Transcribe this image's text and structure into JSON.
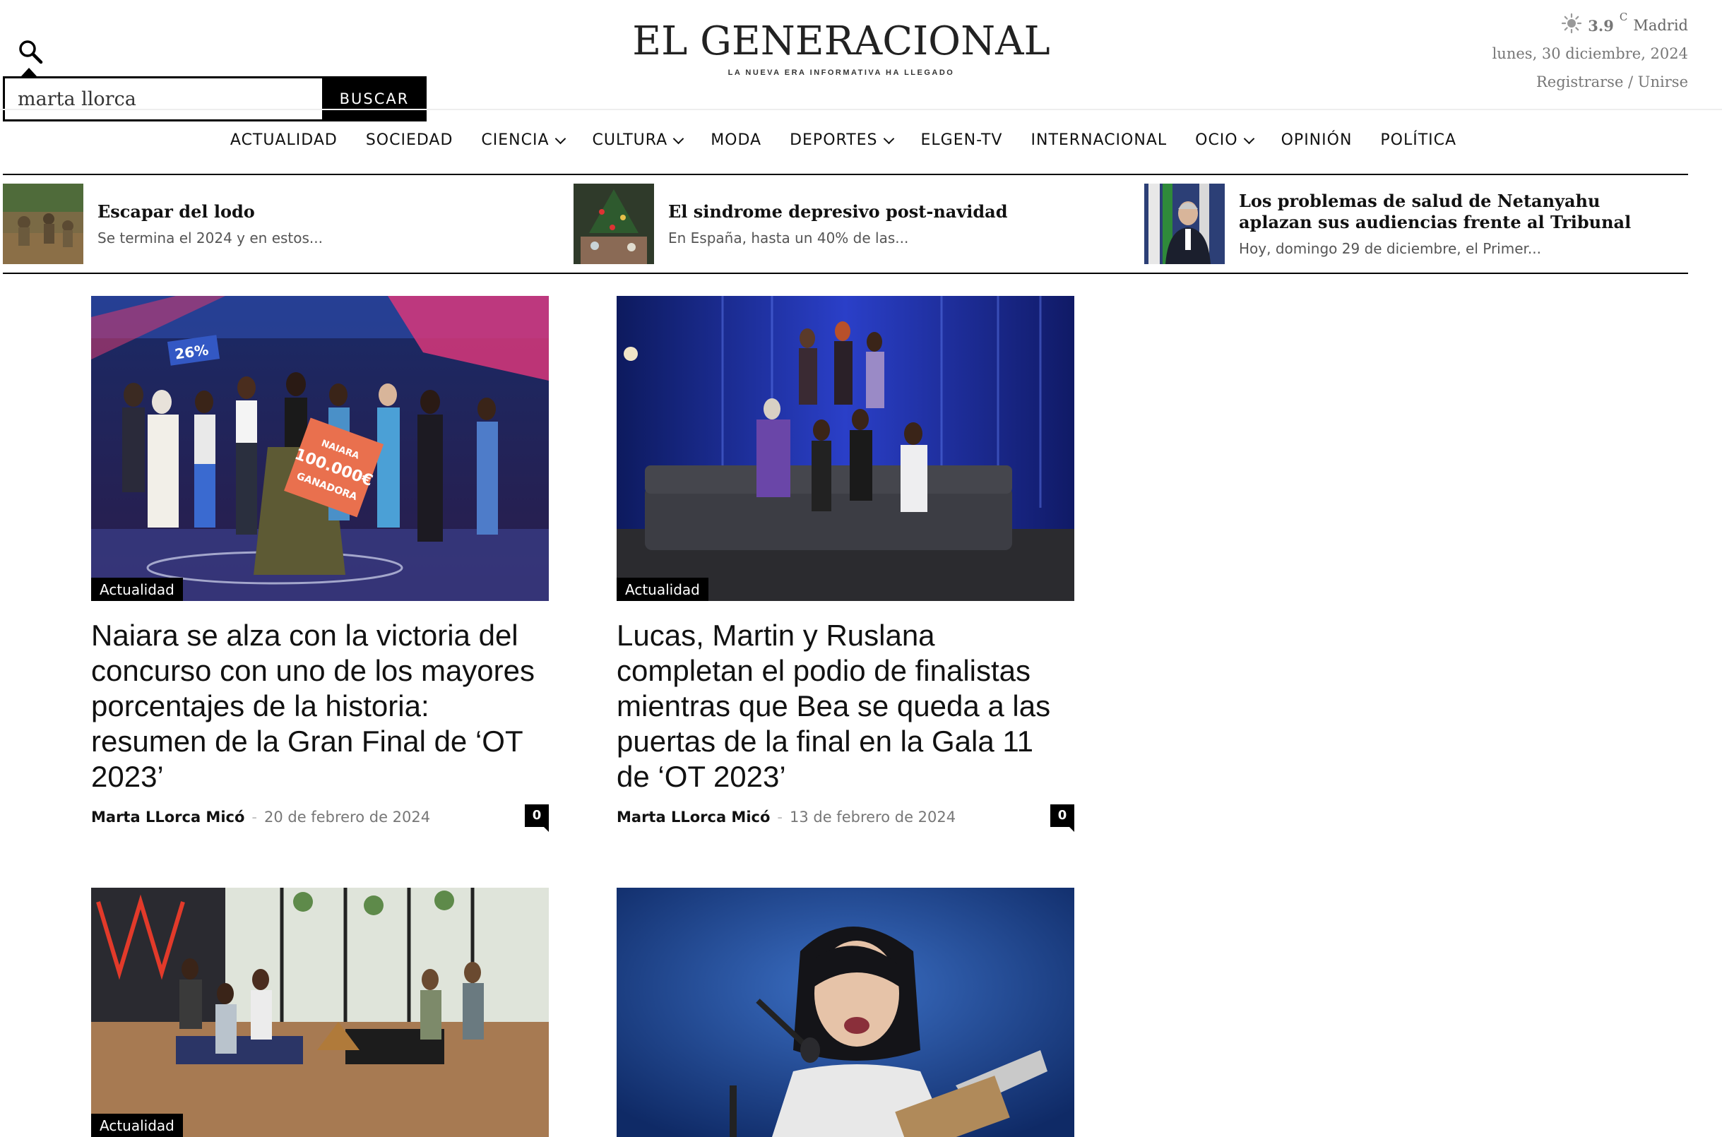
{
  "header": {
    "logo": "EL GENERACIONAL",
    "tagline": "LA NUEVA ERA INFORMATIVA HA LLEGADO",
    "weather": {
      "temp": "3.9",
      "unit": "C",
      "city": "Madrid",
      "icon": "sun-icon"
    },
    "date": "lunes, 30 diciembre, 2024",
    "auth": "Registrarse / Unirse"
  },
  "search": {
    "value": "marta llorca",
    "button_label": "BUSCAR",
    "icon": "search-icon"
  },
  "nav": [
    {
      "label": "ACTUALIDAD",
      "dropdown": false
    },
    {
      "label": "SOCIEDAD",
      "dropdown": false
    },
    {
      "label": "CIENCIA",
      "dropdown": true
    },
    {
      "label": "CULTURA",
      "dropdown": true
    },
    {
      "label": "MODA",
      "dropdown": false
    },
    {
      "label": "DEPORTES",
      "dropdown": true
    },
    {
      "label": "ELGEN-TV",
      "dropdown": false
    },
    {
      "label": "INTERNACIONAL",
      "dropdown": false
    },
    {
      "label": "OCIO",
      "dropdown": true
    },
    {
      "label": "OPINIÓN",
      "dropdown": false
    },
    {
      "label": "POLÍTICA",
      "dropdown": false
    }
  ],
  "ticker": [
    {
      "title": "Escapar del lodo",
      "excerpt": "Se termina el 2024 y en estos..."
    },
    {
      "title": "El sindrome depresivo post-navidad",
      "excerpt": "En España, hasta un 40% de las..."
    },
    {
      "title": "Los problemas de salud de Netanyahu aplazan sus audiencias frente al Tribunal",
      "excerpt": "Hoy, domingo 29 de diciembre, el Primer..."
    }
  ],
  "articles": [
    {
      "category": "Actualidad",
      "title": "Naiara se alza con la victoria del concurso con uno de los mayores porcentajes de la historia: resumen de la Gran Final de ‘OT 2023’",
      "author": "Marta LLorca Micó",
      "separator": "-",
      "date": "20 de febrero de 2024",
      "comments": "0",
      "image_text": [
        "26%",
        "NAIARA",
        "100.000€",
        "GANADORA"
      ]
    },
    {
      "category": "Actualidad",
      "title": "Lucas, Martin y Ruslana completan el podio de finalistas mientras que Bea se queda a las puertas de la final en la Gala 11 de ‘OT 2023’",
      "author": "Marta LLorca Micó",
      "separator": "-",
      "date": "13 de febrero de 2024",
      "comments": "0"
    },
    {
      "category": "Actualidad"
    },
    {
      "category": ""
    }
  ]
}
